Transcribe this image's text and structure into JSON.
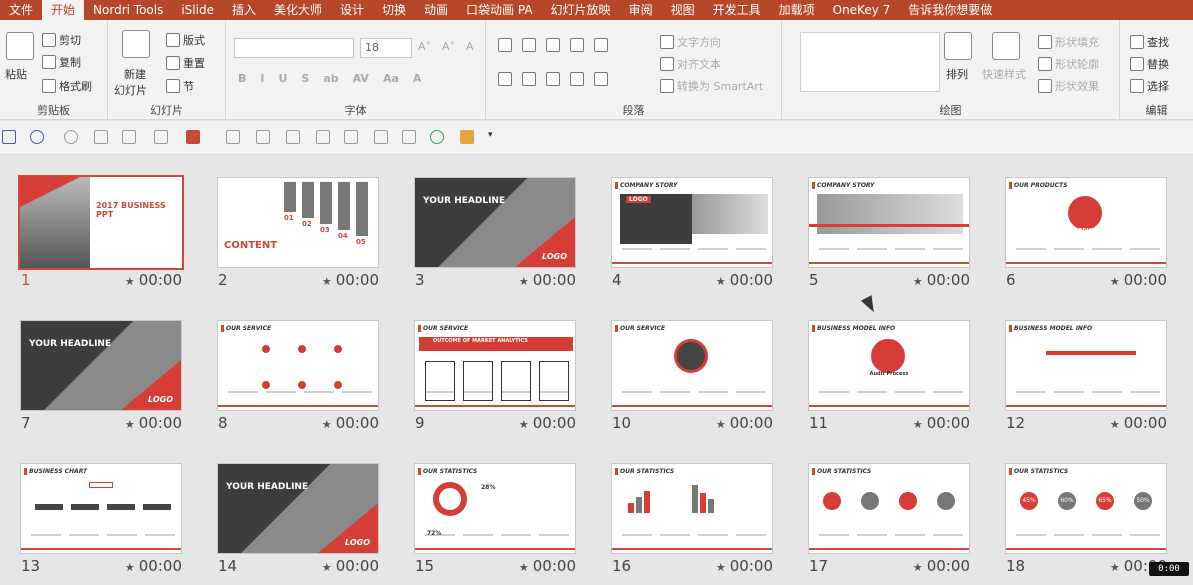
{
  "tabs": [
    "文件",
    "开始",
    "Nordri Tools",
    "iSlide",
    "插入",
    "美化大师",
    "设计",
    "切换",
    "动画",
    "口袋动画 PA",
    "幻灯片放映",
    "审阅",
    "视图",
    "开发工具",
    "加载项",
    "OneKey 7",
    "告诉我你想要做"
  ],
  "active_tab": "开始",
  "ribbon": {
    "clipboard": {
      "paste": "粘贴",
      "cut": "剪切",
      "copy": "复制",
      "format_painter": "格式刷",
      "label": "剪贴板"
    },
    "slides": {
      "new_slide": "新建",
      "new_slide_2": "幻灯片",
      "layout": "版式",
      "reset": "重置",
      "section": "节",
      "label": "幻灯片"
    },
    "font": {
      "font_size": "18",
      "label": "字体",
      "buttons": [
        "B",
        "I",
        "U",
        "S",
        "ab",
        "AV",
        "Aa",
        "A"
      ]
    },
    "paragraph": {
      "text_direction": "文字方向",
      "align_text": "对齐文本",
      "convert_smartart": "转换为 SmartArt",
      "label": "段落"
    },
    "drawing": {
      "arrange": "排列",
      "quick_styles": "快速样式",
      "shape_fill": "形状填充",
      "shape_outline": "形状轮廓",
      "shape_effects": "形状效果",
      "label": "绘图"
    },
    "editing": {
      "find": "查找",
      "replace": "替换",
      "select": "选择",
      "label": "编辑"
    }
  },
  "slides": [
    {
      "num": "1",
      "time": "00:00",
      "kind": "cover",
      "title": "2017 BUSINESS PPT",
      "selected": true
    },
    {
      "num": "2",
      "time": "00:00",
      "kind": "content",
      "title": "CONTENT",
      "items": [
        "01",
        "02",
        "03",
        "04",
        "05"
      ]
    },
    {
      "num": "3",
      "time": "00:00",
      "kind": "dark",
      "title": "YOUR HEADLINE",
      "logo": "LOGO"
    },
    {
      "num": "4",
      "time": "00:00",
      "kind": "story",
      "title": "COMPANY STORY",
      "logo": "LOGO"
    },
    {
      "num": "5",
      "time": "00:00",
      "kind": "story2",
      "title": "COMPANY STORY"
    },
    {
      "num": "6",
      "time": "00:00",
      "kind": "products",
      "title": "OUR PRODUCTS",
      "center": "PRODUCTS LIST"
    },
    {
      "num": "7",
      "time": "00:00",
      "kind": "dark",
      "title": "YOUR HEADLINE",
      "logo": "LOGO"
    },
    {
      "num": "8",
      "time": "00:00",
      "kind": "service",
      "title": "OUR SERVICE"
    },
    {
      "num": "9",
      "time": "00:00",
      "kind": "service2",
      "title": "OUR SERVICE",
      "banner": "OUTCOME OF MARKET ANALYTICS"
    },
    {
      "num": "10",
      "time": "00:00",
      "kind": "service3",
      "title": "OUR SERVICE"
    },
    {
      "num": "11",
      "time": "00:00",
      "kind": "model",
      "title": "BUSINESS MODEL INFO",
      "center": "Audit Process"
    },
    {
      "num": "12",
      "time": "00:00",
      "kind": "model2",
      "title": "BUSINESS MODEL INFO"
    },
    {
      "num": "13",
      "time": "00:00",
      "kind": "chart",
      "title": "BUSINESS CHART"
    },
    {
      "num": "14",
      "time": "00:00",
      "kind": "dark",
      "title": "YOUR HEADLINE",
      "logo": "LOGO"
    },
    {
      "num": "15",
      "time": "00:00",
      "kind": "stats",
      "title": "OUR STATISTICS",
      "values": [
        "28%",
        "72%"
      ]
    },
    {
      "num": "16",
      "time": "00:00",
      "kind": "stats2",
      "title": "OUR STATISTICS"
    },
    {
      "num": "17",
      "time": "00:00",
      "kind": "stats3",
      "title": "OUR STATISTICS"
    },
    {
      "num": "18",
      "time": "00:00",
      "kind": "stats4",
      "title": "OUR STATISTICS",
      "values": [
        "45%",
        "60%",
        "65%",
        "50%"
      ]
    }
  ],
  "clock": "0:00",
  "colors": {
    "accent": "#b7472a",
    "slide_red": "#d63d36"
  }
}
